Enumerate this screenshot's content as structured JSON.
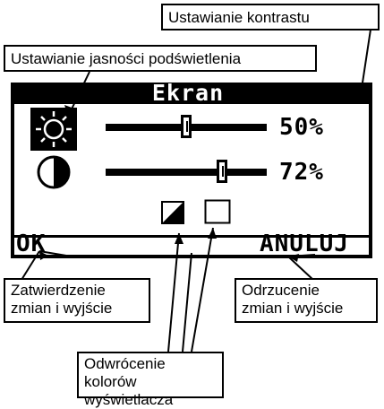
{
  "lcd": {
    "title": "Ekran",
    "ok_label": "OK",
    "cancel_label": "ANULUJ",
    "brightness": {
      "icon": "sun-icon",
      "value_label": "50%",
      "level": 0.5
    },
    "contrast": {
      "icon": "half-circle-icon",
      "value_label": "72%",
      "level": 0.72
    },
    "invert_options": [
      {
        "icon": "inverted-square-icon"
      },
      {
        "icon": "plain-square-icon"
      }
    ]
  },
  "callouts": {
    "contrast": "Ustawianie kontrastu",
    "brightness": "Ustawianie jasności podświetlenia",
    "confirm": {
      "line1": "Zatwierdzenie",
      "line2": "zmian i wyjście"
    },
    "cancel": {
      "line1": "Odrzucenie",
      "line2": "zmian i wyjście"
    },
    "invert": {
      "line1": "Odwrócenie kolorów",
      "line2": "wyświetlacza"
    }
  },
  "colors": {
    "lcd_fg": "#000000",
    "lcd_bg": "#ffffff"
  }
}
